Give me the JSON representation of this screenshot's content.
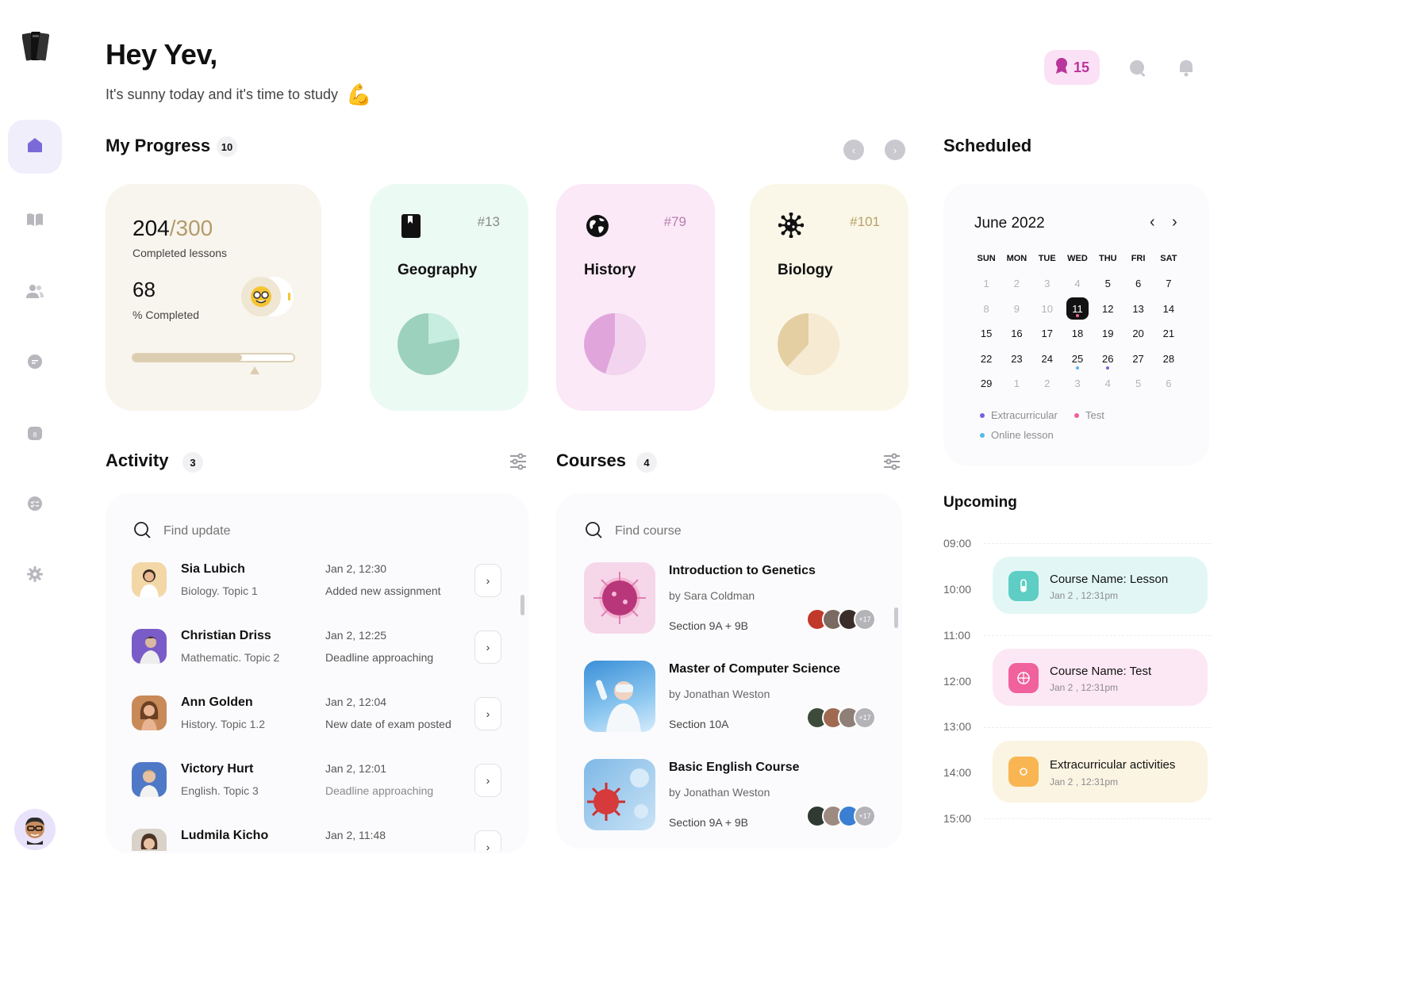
{
  "header": {
    "greeting": "Hey Yev,",
    "subtitle": "It's sunny today and it's time to study",
    "subtitle_emoji": "💪",
    "badge_count": "15"
  },
  "nav": {
    "icons": [
      "home-icon",
      "book-icon",
      "users-icon",
      "chat-icon",
      "calendar-icon",
      "checklist-icon",
      "settings-icon"
    ]
  },
  "progress": {
    "title": "My Progress",
    "count": "10",
    "completed": "204",
    "total": "/300",
    "completed_label": "Completed lessons",
    "percent": "68",
    "percent_label": "% Completed",
    "progress_fraction": 0.68,
    "subjects": [
      {
        "num": "#13",
        "name": "Geography",
        "share": 0.22
      },
      {
        "num": "#79",
        "name": "History",
        "share": 0.55
      },
      {
        "num": "#101",
        "name": "Biology",
        "share": 0.62
      }
    ]
  },
  "activity": {
    "title": "Activity",
    "count": "3",
    "search_placeholder": "Find update",
    "items": [
      {
        "name": "Sia Lubich",
        "topic": "Biology. Topic 1",
        "time": "Jan 2, 12:30",
        "desc": "Added new assignment"
      },
      {
        "name": "Christian Driss",
        "topic": "Mathematic. Topic 2",
        "time": "Jan 2, 12:25",
        "desc": "Deadline approaching"
      },
      {
        "name": "Ann Golden",
        "topic": "History. Topic 1.2",
        "time": "Jan 2, 12:04",
        "desc": "New date of exam posted"
      },
      {
        "name": "Victory Hurt",
        "topic": "English. Topic 3",
        "time": "Jan 2, 12:01",
        "desc": "Deadline approaching"
      },
      {
        "name": "Ludmila Kicho",
        "topic": "",
        "time": "Jan 2, 11:48",
        "desc": ""
      }
    ]
  },
  "courses": {
    "title": "Courses",
    "count": "4",
    "search_placeholder": "Find course",
    "items": [
      {
        "title": "Introduction to Genetics",
        "by": "by Sara Coldman",
        "section": "Section 9A + 9B",
        "more": "+17"
      },
      {
        "title": "Master of Computer Science",
        "by": "by Jonathan Weston",
        "section": "Section 10A",
        "more": "+17"
      },
      {
        "title": "Basic English Course",
        "by": "by Jonathan Weston",
        "section": "Section 9A + 9B",
        "more": "+17"
      }
    ]
  },
  "scheduled": {
    "title": "Scheduled",
    "month": "June 2022",
    "weekdays": [
      "SUN",
      "MON",
      "TUE",
      "WED",
      "THU",
      "FRI",
      "SAT"
    ],
    "weeks": [
      [
        "1",
        "2",
        "3",
        "4",
        "5",
        "6",
        "7"
      ],
      [
        "8",
        "9",
        "10",
        "11",
        "12",
        "13",
        "14"
      ],
      [
        "15",
        "16",
        "17",
        "18",
        "19",
        "20",
        "21"
      ],
      [
        "22",
        "23",
        "24",
        "25",
        "26",
        "27",
        "28"
      ],
      [
        "29",
        "1",
        "2",
        "3",
        "4",
        "5",
        "6"
      ]
    ],
    "legend": {
      "extracurricular": "Extracurricular",
      "test": "Test",
      "online": "Online lesson"
    }
  },
  "upcoming": {
    "title": "Upcoming",
    "times": [
      "09:00",
      "10:00",
      "11:00",
      "12:00",
      "13:00",
      "14:00",
      "15:00"
    ],
    "events": [
      {
        "title": "Course Name: Lesson",
        "sub": "Jan 2 , 12:31pm"
      },
      {
        "title": "Course Name: Test",
        "sub": "Jan 2 , 12:31pm"
      },
      {
        "title": "Extracurricular activities",
        "sub": "Jan 2 , 12:31pm"
      }
    ]
  },
  "colors": {
    "accent": "#6c5dd3",
    "geography": "#9bd1bd",
    "history": "#e0a6dc",
    "biology": "#e4cfa3",
    "lesson": "#5ecdc4",
    "test": "#f0619d",
    "extracurricular": "#f8b551"
  }
}
